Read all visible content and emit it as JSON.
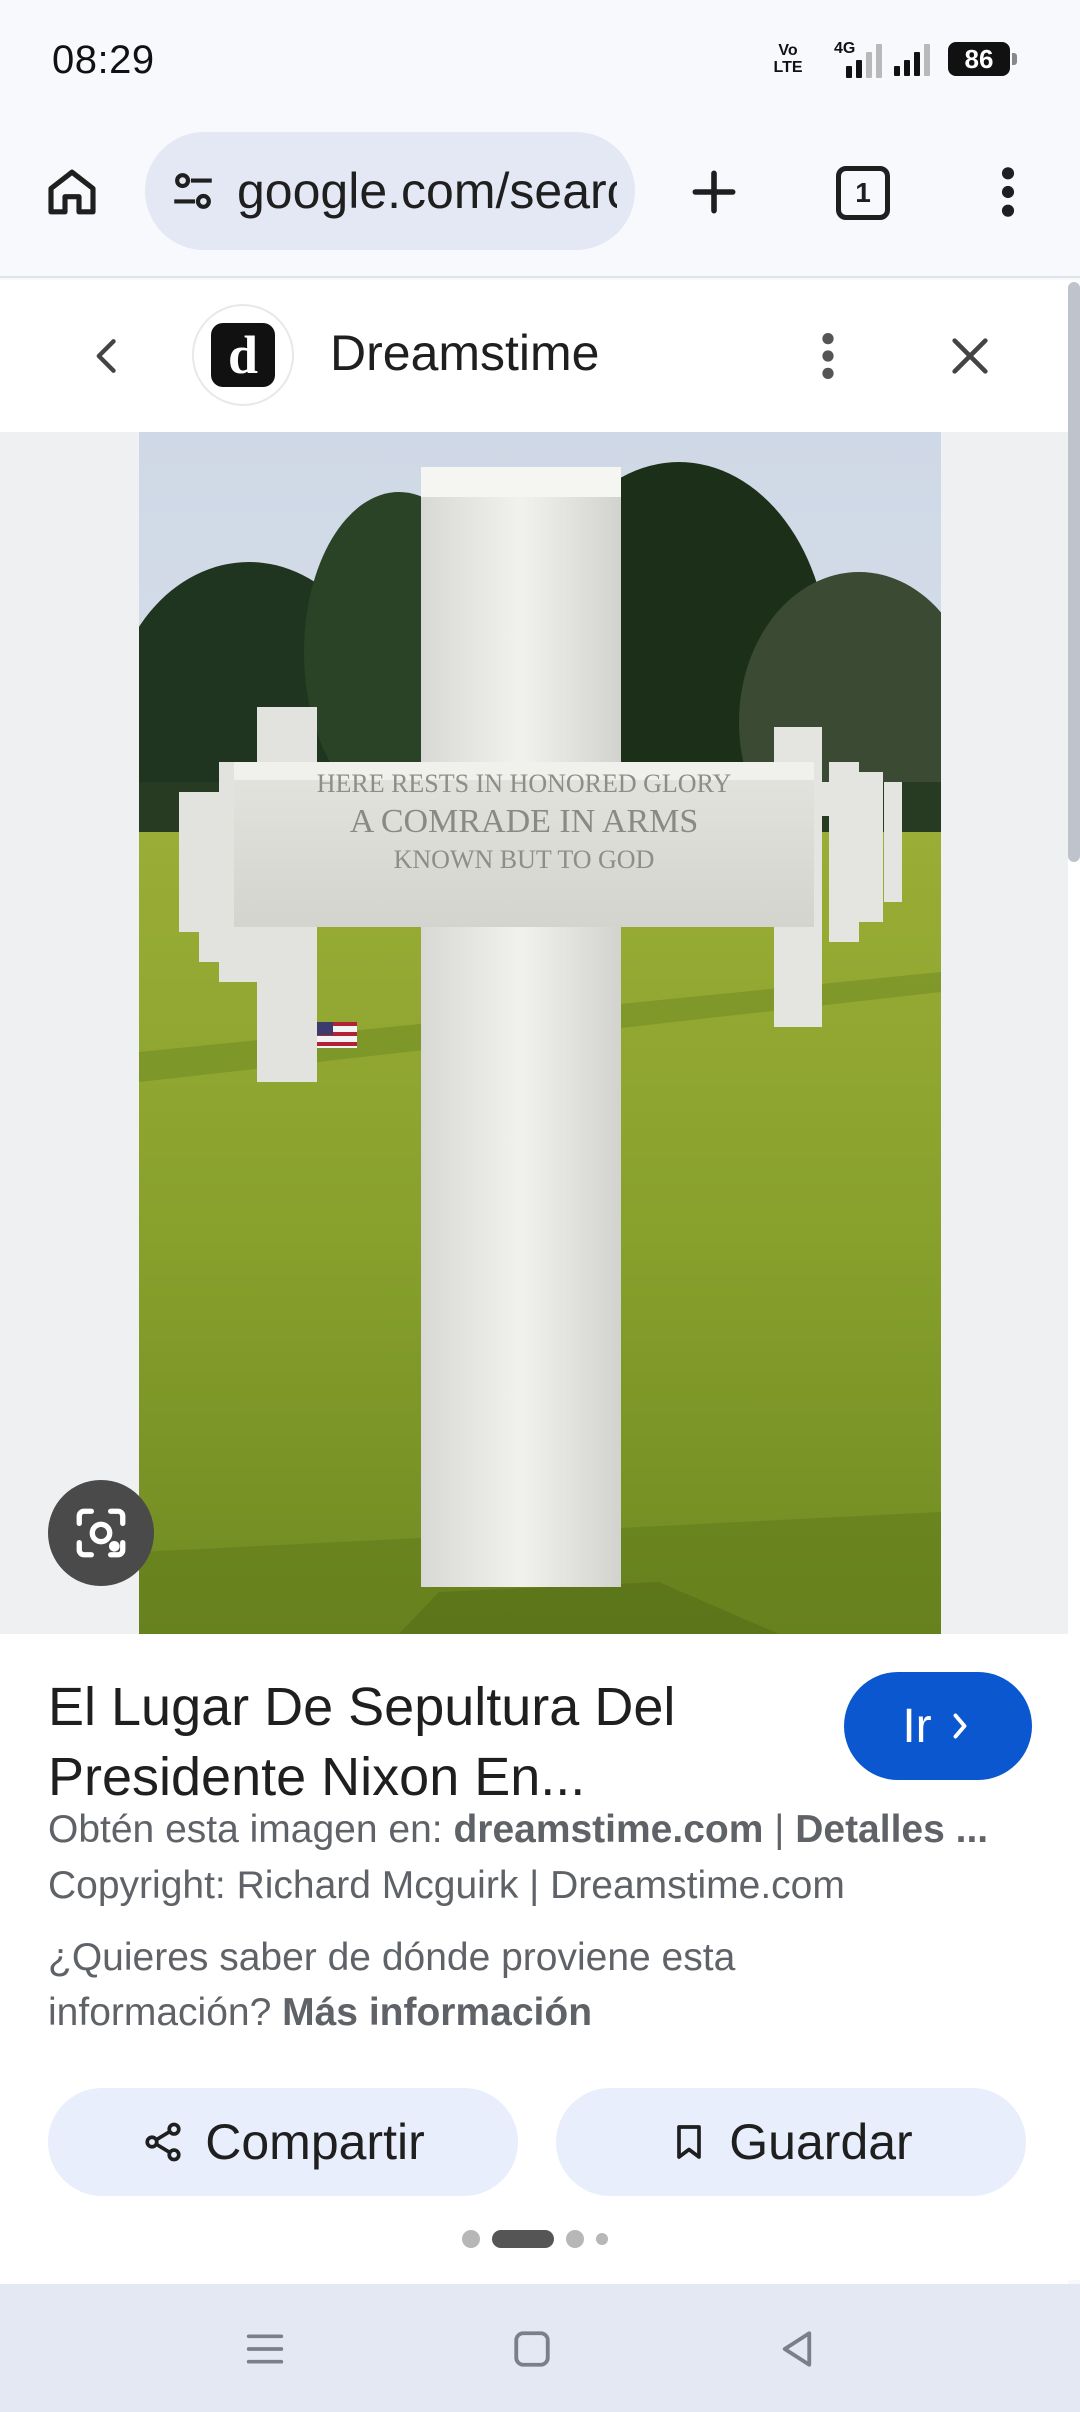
{
  "status": {
    "time": "08:29",
    "volte": "Vo LTE",
    "network": "4G",
    "battery": "86"
  },
  "browser": {
    "url": "google.com/search",
    "tab_count": "1",
    "icons": [
      "home-icon",
      "tune-icon",
      "plus-icon",
      "tab-switcher-icon",
      "more-vert-icon"
    ]
  },
  "panel": {
    "site_name": "Dreamstime",
    "logo_letter": "d"
  },
  "photo": {
    "inscription": [
      "HERE RESTS IN HONORED GLORY",
      "A COMRADE IN ARMS",
      "KNOWN BUT TO GOD"
    ]
  },
  "result": {
    "title": "El Lugar De Sepultura Del Presidente Nixon En...",
    "go_label": "Ir",
    "source_prefix": "Obtén esta imagen en: ",
    "source_site": "dreamstime.com",
    "source_sep": " | ",
    "details_label": "Detalles ...",
    "copyright": "Copyright: Richard Mcguirk | Dreamstime.com",
    "ask_text": "¿Quieres saber de dónde proviene esta información? ",
    "more_info": "Más información",
    "share_label": "Compartir",
    "save_label": "Guardar"
  },
  "carousel": {
    "page_count": 4,
    "active_index": 1
  },
  "colors": {
    "accent": "#0b57d0",
    "pill_bg": "#e8eefb",
    "url_bg": "#e3e8f4",
    "grass": "#8fa82e",
    "marble": "#e9e9e7"
  }
}
